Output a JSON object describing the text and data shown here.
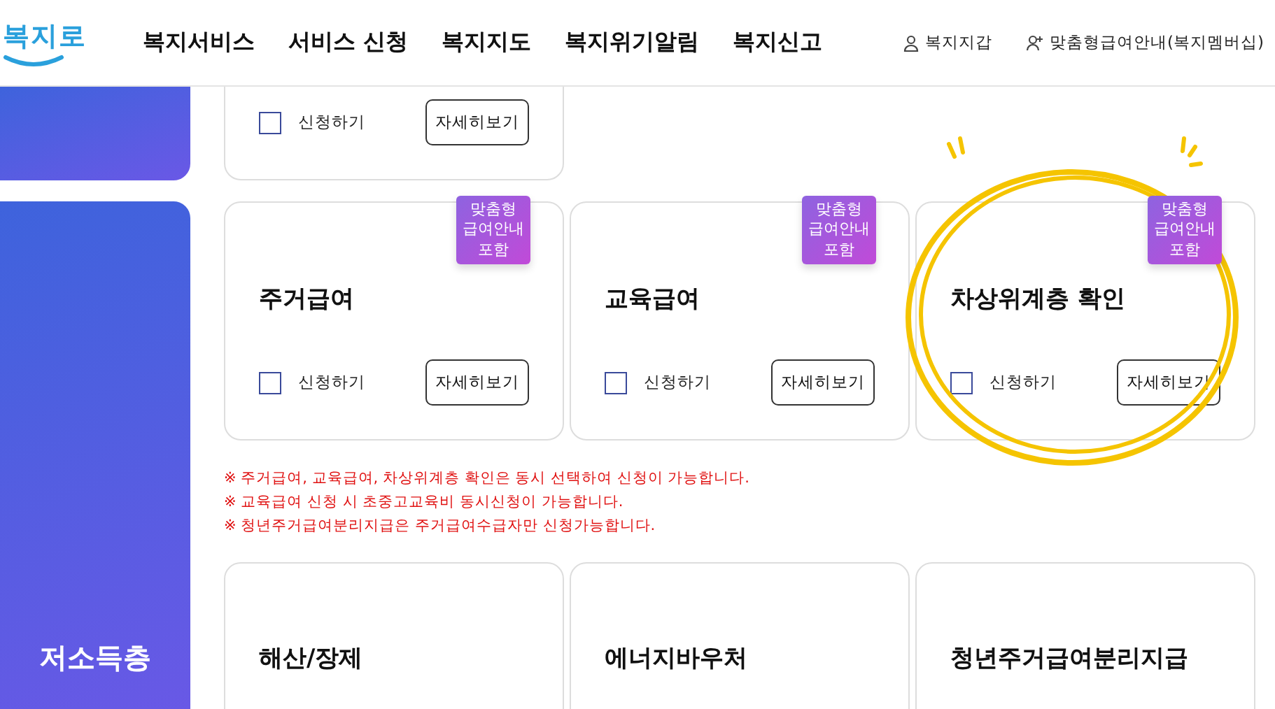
{
  "header": {
    "logo": "복지로",
    "nav": [
      "복지서비스",
      "서비스 신청",
      "복지지도",
      "복지위기알림",
      "복지신고"
    ],
    "user_links": [
      {
        "kind": "wallet",
        "label": "복지지갑"
      },
      {
        "kind": "member",
        "label": "맞춤형급여안내(복지멤버십)"
      }
    ]
  },
  "sidebar": [
    {
      "label": "저소득층"
    }
  ],
  "partial_row": [
    {
      "apply_label": "신청하기",
      "checked": false,
      "button": "자세히보기"
    }
  ],
  "cards": [
    {
      "title": "주거급여",
      "badge": "맞춤형\n급여안내\n포함",
      "apply_label": "신청하기",
      "checked": false,
      "button": "자세히보기"
    },
    {
      "title": "교육급여",
      "badge": "맞춤형\n급여안내\n포함",
      "apply_label": "신청하기",
      "checked": false,
      "button": "자세히보기"
    },
    {
      "title": "차상위계층 확인",
      "badge": "맞춤형\n급여안내\n포함",
      "apply_label": "신청하기",
      "checked": false,
      "button": "자세히보기"
    }
  ],
  "notes": [
    "※ 주거급여, 교육급여, 차상위계층 확인은 동시 선택하여 신청이 가능합니다.",
    "※ 교육급여 신청 시 초중고교육비 동시신청이 가능합니다.",
    "※ 청년주거급여분리지급은 주거급여수급자만 신청가능합니다."
  ],
  "bottom_cards": [
    {
      "title": "해산/장제"
    },
    {
      "title": "에너지바우처"
    },
    {
      "title": "청년주거급여분리지급"
    }
  ]
}
